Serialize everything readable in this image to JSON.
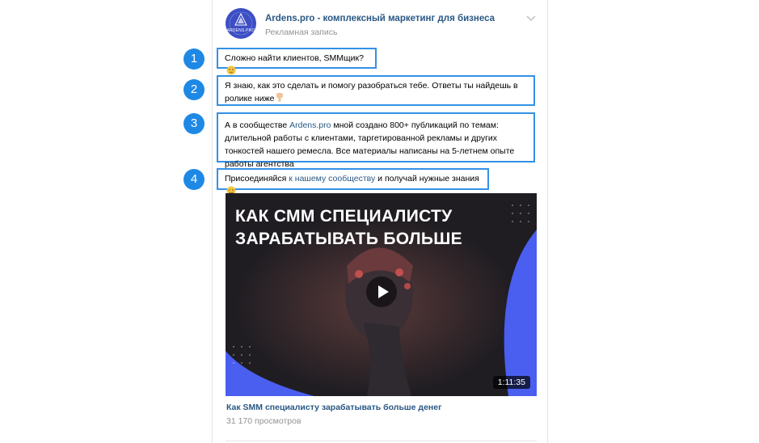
{
  "post": {
    "author": "Ardens.pro - комплексный маркетинг для бизнеса",
    "label": "Рекламная запись",
    "logo_text": "ARDENS.PRO"
  },
  "markers": [
    "1",
    "2",
    "3",
    "4"
  ],
  "paragraphs": {
    "p1": "Сложно найти клиентов, SMMщик?",
    "p2": "Я знаю, как это сделать и помогу разобраться тебе. Ответы ты найдешь в ролике ниже",
    "p3_before": "А в сообществе ",
    "p3_link": "Ardens.pro",
    "p3_after": " мной создано 800+ публикаций по темам: длительной работы с клиентами, таргетированной рекламы и других тонкостей нашего ремесла. Все материалы написаны на 5-летнем опыте работы агентства",
    "p4_before": "Присоединяйся ",
    "p4_link": "к нашему сообществу",
    "p4_after": " и получай нужные знания"
  },
  "video": {
    "headline_line1": "КАК СММ СПЕЦИАЛИСТУ",
    "headline_line2": "ЗАРАБАТЫВАТЬ БОЛЬШЕ",
    "duration": "1:11:35",
    "title": "Как SMM специалисту зарабатывать больше денег",
    "views": "31 170 просмотров"
  },
  "colors": {
    "accent": "#3391e6",
    "badge": "#1e88e5",
    "link": "#2a5885",
    "video_accent": "#4a5ef0"
  }
}
